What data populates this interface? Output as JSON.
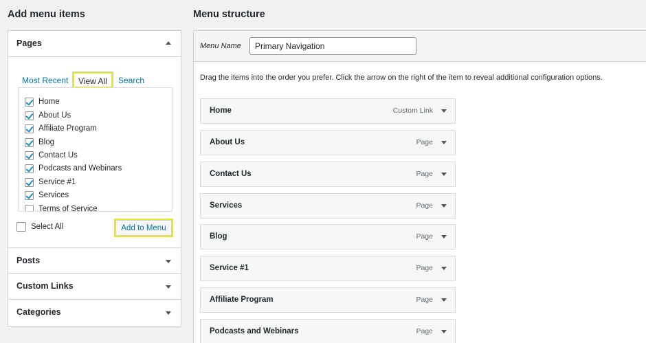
{
  "left": {
    "heading": "Add menu items",
    "pages": {
      "title": "Pages",
      "tabs": {
        "recent": "Most Recent",
        "view_all": "View All",
        "search": "Search"
      },
      "items": [
        {
          "label": "Home",
          "checked": true
        },
        {
          "label": "About Us",
          "checked": true
        },
        {
          "label": "Affiliate Program",
          "checked": true
        },
        {
          "label": "Blog",
          "checked": true
        },
        {
          "label": "Contact Us",
          "checked": true
        },
        {
          "label": "Podcasts and Webinars",
          "checked": true
        },
        {
          "label": "Service #1",
          "checked": true
        },
        {
          "label": "Services",
          "checked": true
        },
        {
          "label": "Terms of Service",
          "checked": false
        }
      ],
      "select_all": "Select All",
      "add_button": "Add to Menu"
    },
    "sections": [
      {
        "title": "Posts"
      },
      {
        "title": "Custom Links"
      },
      {
        "title": "Categories"
      }
    ]
  },
  "right": {
    "heading": "Menu structure",
    "menu_name_label": "Menu Name",
    "menu_name_value": "Primary Navigation",
    "instructions": "Drag the items into the order you prefer. Click the arrow on the right of the item to reveal additional configuration options.",
    "items": [
      {
        "title": "Home",
        "type": "Custom Link"
      },
      {
        "title": "About Us",
        "type": "Page"
      },
      {
        "title": "Contact Us",
        "type": "Page"
      },
      {
        "title": "Services",
        "type": "Page"
      },
      {
        "title": "Blog",
        "type": "Page"
      },
      {
        "title": "Service #1",
        "type": "Page"
      },
      {
        "title": "Affiliate Program",
        "type": "Page"
      },
      {
        "title": "Podcasts and Webinars",
        "type": "Page"
      }
    ]
  },
  "colors": {
    "link": "#0073aa",
    "highlight": "#e6e62a",
    "check": "#1e8cbe"
  }
}
